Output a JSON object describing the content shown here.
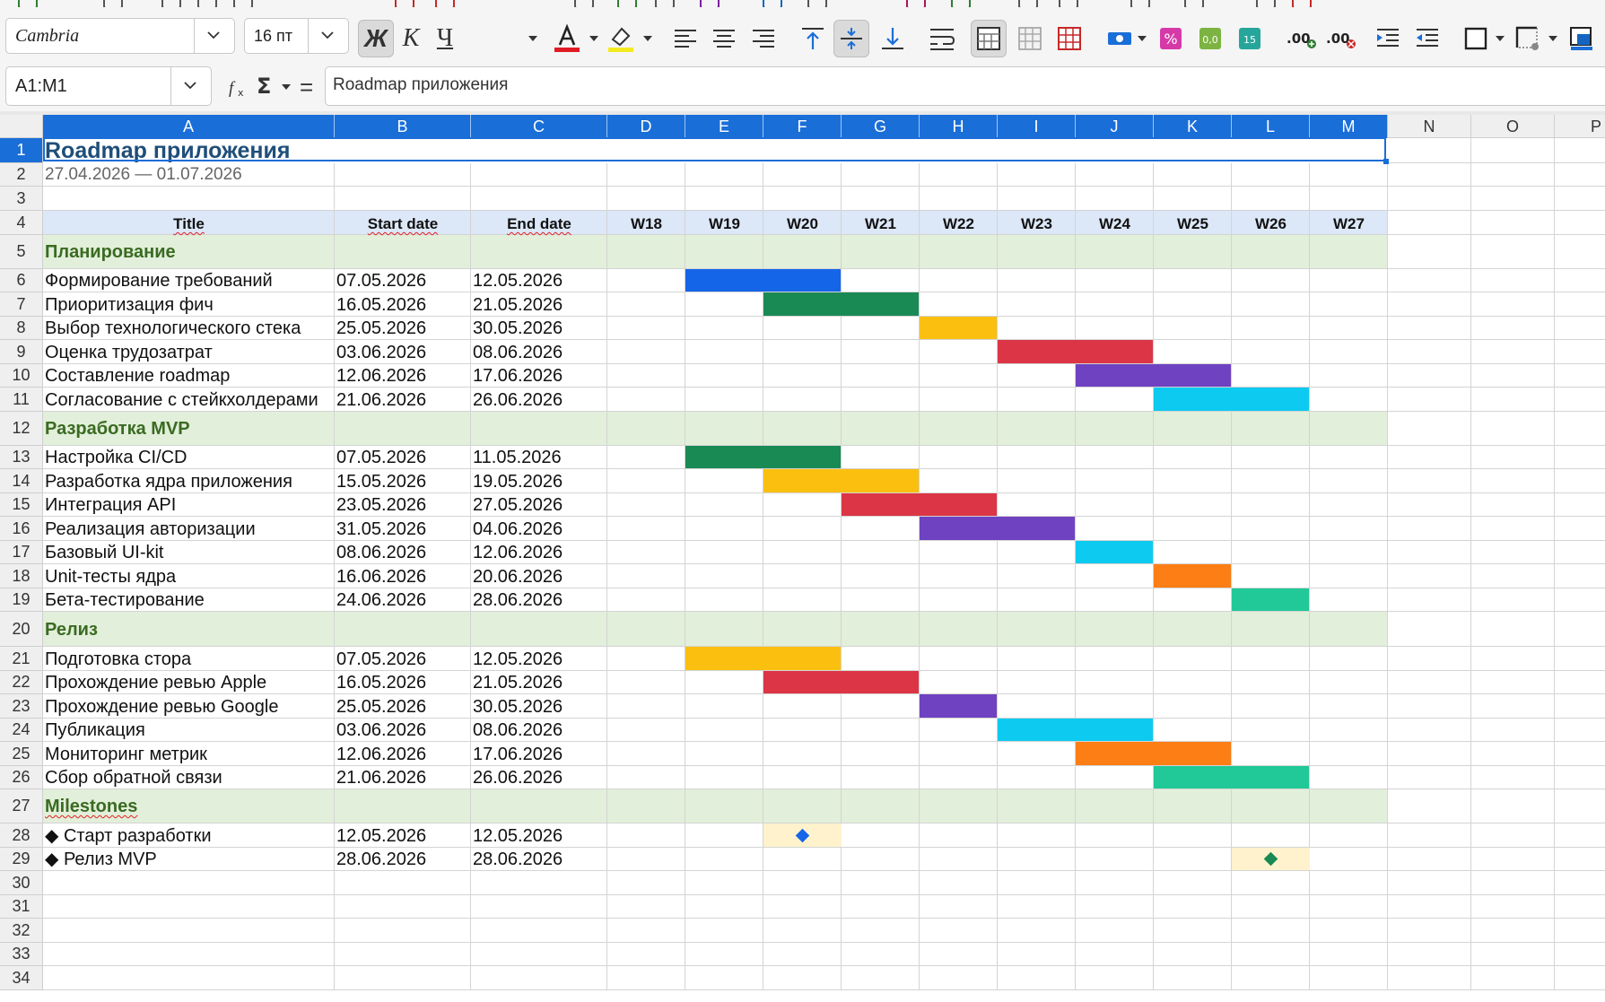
{
  "toolbar": {
    "font_name": "Cambria",
    "font_size": "16 пт",
    "bold_label": "Ж",
    "italic_label": "К",
    "underline_label": "Ч"
  },
  "formula_bar": {
    "name_box": "A1:M1",
    "function_icon": "fx-icon",
    "sum_icon": "sigma-icon",
    "equals_label": "=",
    "content": "Roadmap приложения"
  },
  "columns": [
    "A",
    "B",
    "C",
    "D",
    "E",
    "F",
    "G",
    "H",
    "I",
    "J",
    "K",
    "L",
    "M",
    "N",
    "O",
    "P"
  ],
  "rows": [
    "1",
    "2",
    "3",
    "4",
    "5",
    "6",
    "7",
    "8",
    "9",
    "10",
    "11",
    "12",
    "13",
    "14",
    "15",
    "16",
    "17",
    "18",
    "19",
    "20",
    "21",
    "22",
    "23",
    "24",
    "25",
    "26",
    "27",
    "28",
    "29",
    "30",
    "31",
    "32",
    "33",
    "34"
  ],
  "sheet": {
    "title": "Roadmap приложения",
    "date_range": "27.04.2026 — 01.07.2026",
    "headers": [
      "Title",
      "Start date",
      "End date",
      "W18",
      "W19",
      "W20",
      "W21",
      "W22",
      "W23",
      "W24",
      "W25",
      "W26",
      "W27"
    ],
    "groups": [
      {
        "name": "Планирование",
        "tasks": [
          {
            "title": "Формирование требований",
            "start": "07.05.2026",
            "end": "12.05.2026",
            "w0": 4,
            "w1": 5,
            "color": "#1565e8"
          },
          {
            "title": "Приоритизация фич",
            "start": "16.05.2026",
            "end": "21.05.2026",
            "w0": 5,
            "w1": 6,
            "color": "#1a8a55"
          },
          {
            "title": "Выбор технологического стека",
            "start": "25.05.2026",
            "end": "30.05.2026",
            "w0": 7,
            "w1": 7,
            "color": "#fbbf0f"
          },
          {
            "title": "Оценка трудозатрат",
            "start": "03.06.2026",
            "end": "08.06.2026",
            "w0": 8,
            "w1": 9,
            "color": "#dc3545"
          },
          {
            "title": "Составление roadmap",
            "start": "12.06.2026",
            "end": "17.06.2026",
            "w0": 9,
            "w1": 10,
            "color": "#6f42c1"
          },
          {
            "title": "Согласование с стейкхолдерами",
            "start": "21.06.2026",
            "end": "26.06.2026",
            "w0": 10,
            "w1": 11,
            "color": "#0dcaf0"
          }
        ]
      },
      {
        "name": "Разработка MVP",
        "tasks": [
          {
            "title": "Настройка CI/CD",
            "start": "07.05.2026",
            "end": "11.05.2026",
            "w0": 4,
            "w1": 5,
            "color": "#1a8a55"
          },
          {
            "title": "Разработка ядра приложения",
            "start": "15.05.2026",
            "end": "19.05.2026",
            "w0": 5,
            "w1": 6,
            "color": "#fbbf0f"
          },
          {
            "title": "Интеграция API",
            "start": "23.05.2026",
            "end": "27.05.2026",
            "w0": 6,
            "w1": 7,
            "color": "#dc3545"
          },
          {
            "title": "Реализация авторизации",
            "start": "31.05.2026",
            "end": "04.06.2026",
            "w0": 7,
            "w1": 8,
            "color": "#6f42c1"
          },
          {
            "title": "Базовый UI-kit",
            "start": "08.06.2026",
            "end": "12.06.2026",
            "w0": 9,
            "w1": 9,
            "color": "#0dcaf0"
          },
          {
            "title": "Unit-тесты ядра",
            "start": "16.06.2026",
            "end": "20.06.2026",
            "w0": 10,
            "w1": 10,
            "color": "#fd7e14"
          },
          {
            "title": "Бета-тестирование",
            "start": "24.06.2026",
            "end": "28.06.2026",
            "w0": 11,
            "w1": 11,
            "color": "#20c997"
          }
        ]
      },
      {
        "name": "Релиз",
        "tasks": [
          {
            "title": "Подготовка стора",
            "start": "07.05.2026",
            "end": "12.05.2026",
            "w0": 4,
            "w1": 5,
            "color": "#fbbf0f"
          },
          {
            "title": "Прохождение ревью Apple",
            "start": "16.05.2026",
            "end": "21.05.2026",
            "w0": 5,
            "w1": 6,
            "color": "#dc3545"
          },
          {
            "title": "Прохождение ревью Google",
            "start": "25.05.2026",
            "end": "30.05.2026",
            "w0": 7,
            "w1": 7,
            "color": "#6f42c1"
          },
          {
            "title": "Публикация",
            "start": "03.06.2026",
            "end": "08.06.2026",
            "w0": 8,
            "w1": 9,
            "color": "#0dcaf0"
          },
          {
            "title": "Мониторинг метрик",
            "start": "12.06.2026",
            "end": "17.06.2026",
            "w0": 9,
            "w1": 10,
            "color": "#fd7e14"
          },
          {
            "title": "Сбор обратной связи",
            "start": "21.06.2026",
            "end": "26.06.2026",
            "w0": 10,
            "w1": 11,
            "color": "#20c997"
          }
        ]
      },
      {
        "name": "Milestones",
        "tasks": [
          {
            "title": "◆ Старт разработки",
            "start": "12.05.2026",
            "end": "12.05.2026",
            "w0": 5,
            "w1": 5,
            "milestone": true,
            "color": "#1565e8"
          },
          {
            "title": "◆ Релиз MVP",
            "start": "28.06.2026",
            "end": "28.06.2026",
            "w0": 11,
            "w1": 11,
            "milestone": true,
            "color": "#1a8a55"
          }
        ]
      }
    ]
  },
  "colors": {
    "header_bg": "#1a6ed8",
    "table_header_bg": "#dce7f7",
    "group_bg": "#e2efda",
    "group_text": "#3a6b22",
    "title_text": "#1f4e79",
    "milestone_bg": "#fff2cc"
  }
}
